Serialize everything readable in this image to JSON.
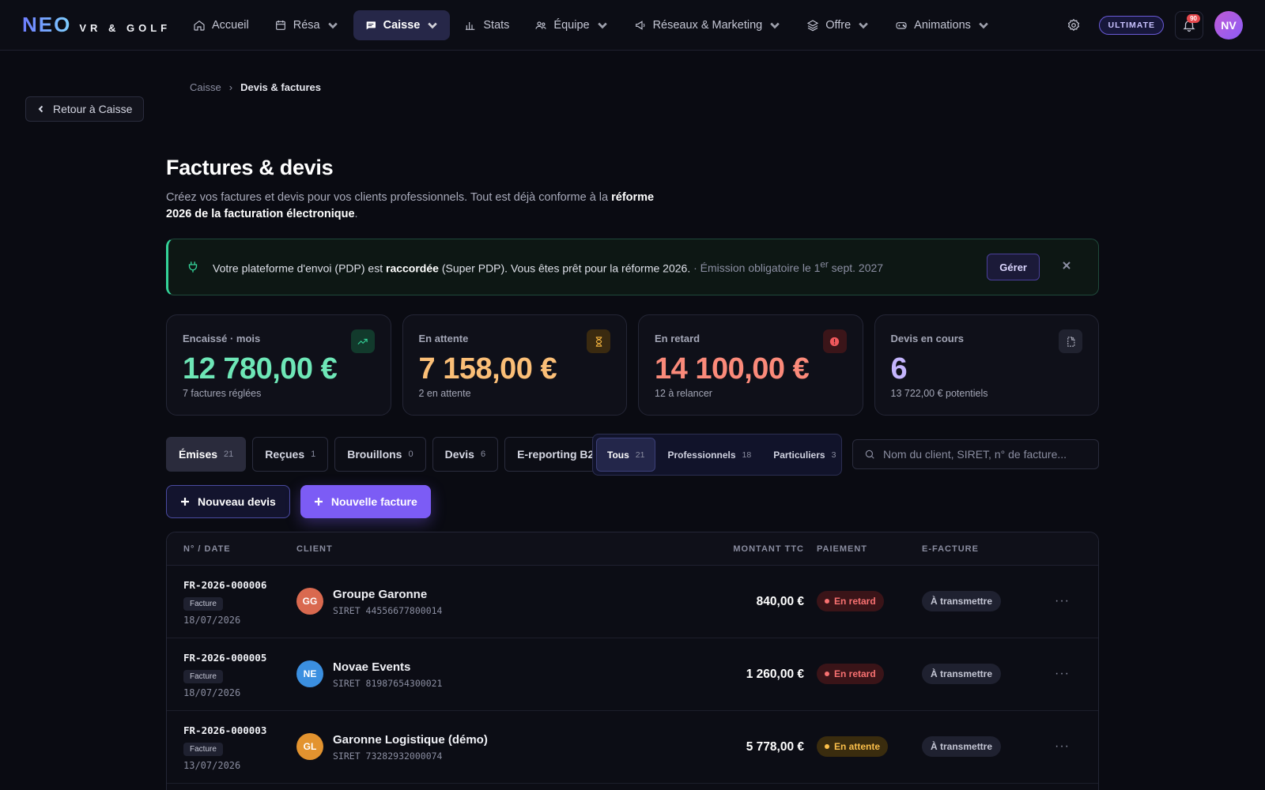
{
  "brand": {
    "name": "NEO",
    "subtitle": "VR & GOLF"
  },
  "nav": [
    {
      "label": "Accueil",
      "icon": "home-icon",
      "dropdown": false,
      "active": false
    },
    {
      "label": "Résa",
      "icon": "calendar-icon",
      "dropdown": true,
      "active": false
    },
    {
      "label": "Caisse",
      "icon": "register-icon",
      "dropdown": true,
      "active": true
    },
    {
      "label": "Stats",
      "icon": "bar-chart-icon",
      "dropdown": false,
      "active": false
    },
    {
      "label": "Équipe",
      "icon": "users-icon",
      "dropdown": true,
      "active": false
    },
    {
      "label": "Réseaux & Marketing",
      "icon": "megaphone-icon",
      "dropdown": true,
      "active": false
    },
    {
      "label": "Offre",
      "icon": "layers-icon",
      "dropdown": true,
      "active": false
    },
    {
      "label": "Animations",
      "icon": "gamepad-icon",
      "dropdown": true,
      "active": false
    }
  ],
  "topbar": {
    "plan": "ULTIMATE",
    "notifications": "90",
    "user_initials": "NV"
  },
  "back_button": "Retour à Caisse",
  "breadcrumb": {
    "parent": "Caisse",
    "current": "Devis & factures"
  },
  "page": {
    "title": "Factures & devis",
    "subtitle_start": "Créez vos factures et devis pour vos clients professionnels. Tout est déjà conforme à la ",
    "subtitle_bold": "réforme 2026 de la facturation électronique",
    "subtitle_end": "."
  },
  "banner": {
    "text_start": "Votre plateforme d'envoi (PDP) est ",
    "text_bold": "raccordée",
    "text_end": " (Super PDP). Vous êtes prêt pour la réforme 2026.",
    "note_prefix": " · Émission obligatoire le 1",
    "note_sup": "er",
    "note_suffix": " sept. 2027",
    "button": "Gérer"
  },
  "stats": [
    {
      "label": "Encaissé · mois",
      "value": "12 780,00 €",
      "sub": "7 factures réglées",
      "color": "#6ee7b7",
      "icon": "trending-up-icon",
      "icon_bg": "#123a2c",
      "icon_color": "#34d399"
    },
    {
      "label": "En attente",
      "value": "7 158,00 €",
      "sub": "2 en attente",
      "color": "#fbbf77",
      "icon": "hourglass-icon",
      "icon_bg": "#3a2a10",
      "icon_color": "#f5b53f"
    },
    {
      "label": "En retard",
      "value": "14 100,00 €",
      "sub": "12 à relancer",
      "color": "#fb8a7a",
      "icon": "alert-icon",
      "icon_bg": "#3b1519",
      "icon_color": "#f0585c"
    },
    {
      "label": "Devis en cours",
      "value": "6",
      "sub": "13 722,00 € potentiels",
      "color": "#c4b5fd",
      "icon": "document-icon",
      "icon_bg": "#20222f",
      "icon_color": "#b7b9c8"
    }
  ],
  "tabs": [
    {
      "label": "Émises",
      "count": "21",
      "active": true
    },
    {
      "label": "Reçues",
      "count": "1",
      "active": false
    },
    {
      "label": "Brouillons",
      "count": "0",
      "active": false
    },
    {
      "label": "Devis",
      "count": "6",
      "active": false
    },
    {
      "label": "E-reporting B2C",
      "count": "",
      "active": false
    }
  ],
  "segments": [
    {
      "label": "Tous",
      "count": "21",
      "active": true
    },
    {
      "label": "Professionnels",
      "count": "18",
      "active": false
    },
    {
      "label": "Particuliers",
      "count": "3",
      "active": false
    }
  ],
  "search": {
    "placeholder": "Nom du client, SIRET, n° de facture..."
  },
  "actions": {
    "new_quote": "Nouveau devis",
    "new_invoice": "Nouvelle facture"
  },
  "table": {
    "columns": {
      "number_date": "N° / DATE",
      "client": "CLIENT",
      "amount": "MONTANT TTC",
      "payment": "PAIEMENT",
      "einvoice": "E-FACTURE"
    },
    "rows": [
      {
        "number": "FR-2026-000006",
        "type": "Facture",
        "date": "18/07/2026",
        "initials": "GG",
        "avatar_color": "#d9694f",
        "client": "Groupe Garonne",
        "siret": "SIRET 44556677800014",
        "amount": "840,00 €",
        "payment": "En retard",
        "payment_color": "#f87171",
        "payment_bg": "#3a1418",
        "einvoice": "À transmettre"
      },
      {
        "number": "FR-2026-000005",
        "type": "Facture",
        "date": "18/07/2026",
        "initials": "NE",
        "avatar_color": "#3b8fe0",
        "client": "Novae Events",
        "siret": "SIRET 81987654300021",
        "amount": "1 260,00 €",
        "payment": "En retard",
        "payment_color": "#f87171",
        "payment_bg": "#3a1418",
        "einvoice": "À transmettre"
      },
      {
        "number": "FR-2026-000003",
        "type": "Facture",
        "date": "13/07/2026",
        "initials": "GL",
        "avatar_color": "#e3932f",
        "client": "Garonne Logistique (démo)",
        "siret": "SIRET 73282932000074",
        "amount": "5 778,00 €",
        "payment": "En attente",
        "payment_color": "#fbbf4a",
        "payment_bg": "#3a2c0e",
        "einvoice": "À transmettre"
      }
    ]
  }
}
